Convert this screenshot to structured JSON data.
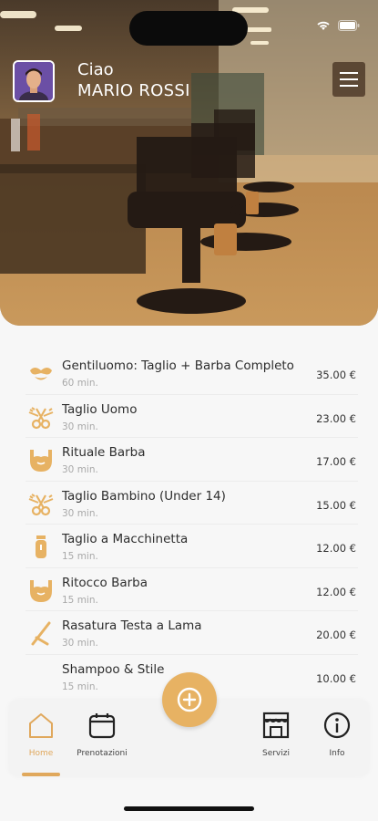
{
  "header": {
    "greeting": "Ciao",
    "user_name": "MARIO ROSSI"
  },
  "services": [
    {
      "title": "Gentiluomo: Taglio + Barba Completo",
      "duration": "60 min.",
      "price": "35.00 €",
      "icon": "mustache-icon"
    },
    {
      "title": "Taglio Uomo",
      "duration": "30 min.",
      "price": "23.00 €",
      "icon": "scissors-comb-icon"
    },
    {
      "title": "Rituale Barba",
      "duration": "30 min.",
      "price": "17.00 €",
      "icon": "beard-icon"
    },
    {
      "title": "Taglio Bambino (Under 14)",
      "duration": "30 min.",
      "price": "15.00 €",
      "icon": "scissors-comb-icon"
    },
    {
      "title": "Taglio a Macchinetta",
      "duration": "15 min.",
      "price": "12.00 €",
      "icon": "clipper-icon"
    },
    {
      "title": "Ritocco Barba",
      "duration": "15 min.",
      "price": "12.00 €",
      "icon": "beard-icon"
    },
    {
      "title": "Rasatura Testa a Lama",
      "duration": "30 min.",
      "price": "20.00 €",
      "icon": "razor-icon"
    },
    {
      "title": "Shampoo & Stile",
      "duration": "15 min.",
      "price": "10.00 €",
      "icon": "none"
    }
  ],
  "nav": {
    "home": "Home",
    "bookings": "Prenotazioni",
    "services": "Servizi",
    "info": "Info",
    "active": "home"
  },
  "colors": {
    "accent": "#e7b263",
    "active_label": "#e0a85c"
  }
}
